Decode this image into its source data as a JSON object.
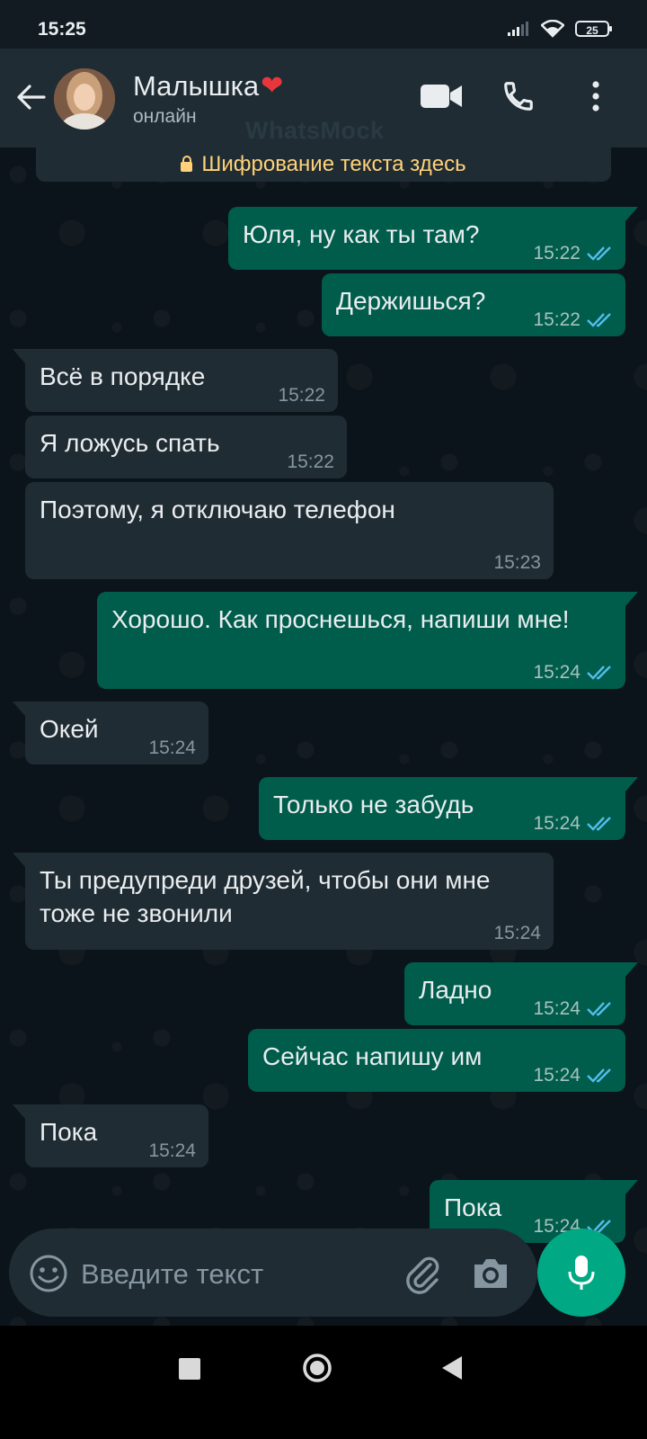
{
  "status_bar": {
    "time": "15:25",
    "battery": "25"
  },
  "header": {
    "contact_name": "Малышка",
    "contact_status": "онлайн",
    "watermark": "WhatsMock"
  },
  "encryption_banner": "Шифрование текста здесь",
  "messages": [
    {
      "direction": "out",
      "text": "Юля, ну как ты там?",
      "time": "15:22",
      "read": true
    },
    {
      "direction": "out",
      "text": "Держишься?",
      "time": "15:22",
      "read": true
    },
    {
      "direction": "in",
      "text": "Всё в порядке",
      "time": "15:22"
    },
    {
      "direction": "in",
      "text": "Я ложусь спать",
      "time": "15:22"
    },
    {
      "direction": "in",
      "text": "Поэтому, я отключаю телефон",
      "time": "15:23"
    },
    {
      "direction": "out",
      "text": "Хорошо. Как проснешься, напиши мне!",
      "time": "15:24",
      "read": true
    },
    {
      "direction": "in",
      "text": "Окей",
      "time": "15:24"
    },
    {
      "direction": "out",
      "text": "Только не забудь",
      "time": "15:24",
      "read": true
    },
    {
      "direction": "in",
      "text": "Ты предупреди друзей, чтобы они мне тоже не звонили",
      "time": "15:24"
    },
    {
      "direction": "out",
      "text": "Ладно",
      "time": "15:24",
      "read": true
    },
    {
      "direction": "out",
      "text": "Сейчас напишу им",
      "time": "15:24",
      "read": true
    },
    {
      "direction": "in",
      "text": "Пока",
      "time": "15:24"
    },
    {
      "direction": "out",
      "text": "Пока",
      "time": "15:24",
      "read": true
    }
  ],
  "input": {
    "placeholder": "Введите текст"
  },
  "colors": {
    "incoming_bubble": "#202c33",
    "outgoing_bubble": "#005c4b",
    "accent": "#00a884",
    "read_ticks": "#53bdeb",
    "banner_text": "#ffd279"
  },
  "icons": {
    "back": "arrow-left-icon",
    "video": "video-camera-icon",
    "call": "phone-icon",
    "menu": "more-vertical-icon",
    "emoji": "emoji-icon",
    "attach": "paperclip-icon",
    "camera": "camera-icon",
    "mic": "microphone-icon"
  }
}
